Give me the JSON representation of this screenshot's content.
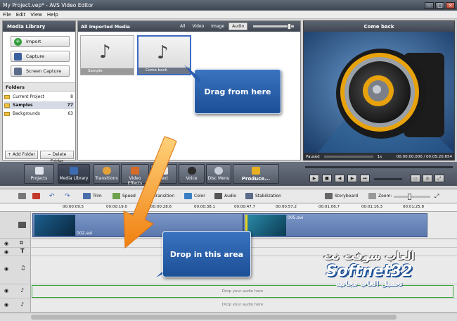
{
  "app": {
    "title": "My Project.vep* - AVS Video Editor"
  },
  "menu": [
    "File",
    "Edit",
    "View",
    "Help"
  ],
  "media_library": {
    "title": "Media Library",
    "buttons": [
      "Import",
      "Capture",
      "Screen Capture"
    ],
    "folders_title": "Folders",
    "folders": [
      {
        "name": "Current Project",
        "count": "8"
      },
      {
        "name": "Samples",
        "count": "77"
      },
      {
        "name": "Backgrounds",
        "count": "63"
      }
    ],
    "add_folder": "+ Add Folder",
    "delete_folder": "− Delete Folder"
  },
  "imported": {
    "title": "All Imported Media",
    "filters": [
      "All",
      "Video",
      "Image",
      "Audio"
    ],
    "active_filter": "Audio",
    "items": [
      {
        "name": "Sample"
      },
      {
        "name": "Come back"
      }
    ]
  },
  "preview": {
    "title": "Come back",
    "status": "Paused",
    "speed": "1x",
    "time": "00:00:00.000 / 00:05:20.654"
  },
  "main_toolbar": [
    "Projects",
    "Media Library",
    "Transitions",
    "Video Effects",
    "Text",
    "Voice",
    "Disc Menu",
    "Produce..."
  ],
  "edit_toolbar": {
    "items": [
      "Trim",
      "Speed",
      "Transition",
      "Color",
      "Audio",
      "Stabilization"
    ],
    "storyboard": "Storyboard",
    "zoom": "Zoom:"
  },
  "ruler": [
    "00:00:09.5",
    "00:00:19.0",
    "00:00:28.6",
    "00:00:38.1",
    "00:00:47.7",
    "00:00:57.2",
    "00:01:06.7",
    "00:01:16.3",
    "00:01:25.8"
  ],
  "clips": [
    {
      "name": "002.avi"
    },
    {
      "name": "005.avi"
    }
  ],
  "drop_audio": "Drop your audio here",
  "callouts": {
    "drag": "Drag from here",
    "drop": "Drop in this area"
  },
  "watermark": {
    "ar1": "العاب سوفت نت",
    "brand": "Softnet32",
    "ar2": "تحميل العاب مجانية"
  },
  "colors": {
    "accent": "#2a5fae",
    "header": "#4a515d",
    "audio_border": "#3aa63a"
  }
}
